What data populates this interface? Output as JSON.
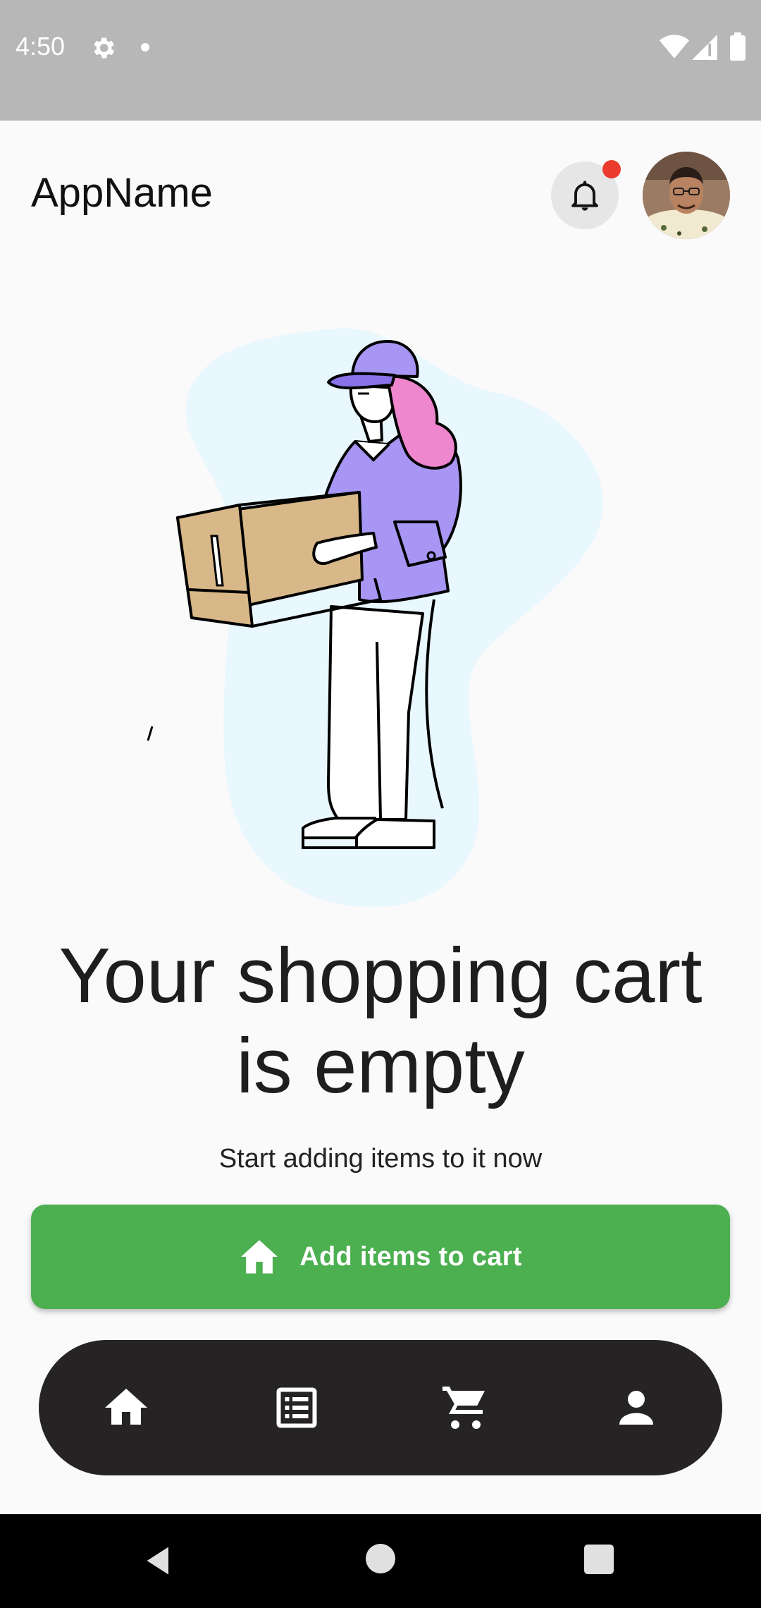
{
  "status_bar": {
    "time": "4:50",
    "icons": [
      "gear-icon",
      "notification-dot",
      "wifi-icon",
      "cell-signal-icon",
      "battery-icon"
    ]
  },
  "app_bar": {
    "title": "AppName",
    "notification_icon": "bell-icon",
    "has_unread_notification": true,
    "avatar": "user-avatar"
  },
  "empty_state": {
    "illustration": "woman-holding-box",
    "title": "Your shopping cart is empty",
    "subtitle": "Start adding items to it now",
    "cta": {
      "label": "Add items to cart",
      "icon": "home-icon"
    }
  },
  "bottom_nav": {
    "items": [
      {
        "name": "home",
        "icon": "home-icon"
      },
      {
        "name": "orders",
        "icon": "list-icon"
      },
      {
        "name": "cart",
        "icon": "cart-icon"
      },
      {
        "name": "profile",
        "icon": "person-icon"
      }
    ]
  },
  "colors": {
    "primary_green": "#4caf50",
    "nav_background": "#262324",
    "notification_dot": "#ea3b2e",
    "page_background": "#fafafa",
    "status_bar": "#b7b7b7"
  }
}
